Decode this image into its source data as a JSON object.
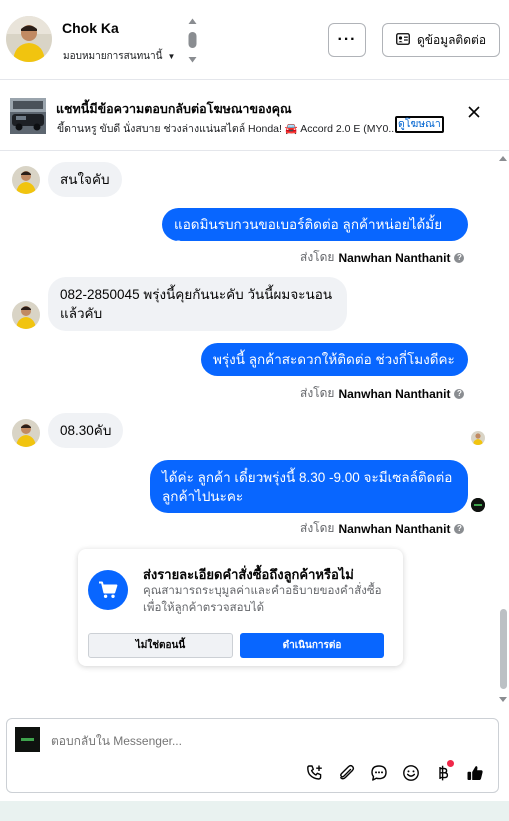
{
  "header": {
    "contact_name": "Chok Ka",
    "assign_label": "มอบหมายการสนทนานี้",
    "more_label": "···",
    "details_label": "ดูข้อมูลติดต่อ"
  },
  "ad_banner": {
    "title": "แชทนี้มีข้อความตอบกลับต่อโฆษณาของคุณ",
    "subtitle": "ขี้ดานหรู ขับดี นั่งสบาย ช่วงล่างแน่นสไตล์ Honda! 🚘 Accord 2.0 E (MY0...",
    "view_ad_label": "ดูโฆษณา"
  },
  "messages": [
    {
      "dir": "in",
      "text": "สนใจคับ"
    },
    {
      "dir": "out",
      "text": "แอดมินรบกวนขอเบอร์ติดต่อ ลูกค้าหน่อยได้มั้ยคะ",
      "sent_by_prefix": "ส่งโดย",
      "sender": "Nanwhan Nanthanit"
    },
    {
      "dir": "in",
      "text": "082-2850045 พรุ่งนี้คุยกันนะคับ วันนี้ผมจะนอนแล้วคับ"
    },
    {
      "dir": "out",
      "text": "พรุ่งนี้ ลูกค้าสะดวกให้ติดต่อ ช่วงกี่โมงดีคะ",
      "sent_by_prefix": "ส่งโดย",
      "sender": "Nanwhan Nanthanit"
    },
    {
      "dir": "in",
      "text": "08.30คับ"
    },
    {
      "dir": "out",
      "text": "ได้ค่ะ  ลูกค้า เดี๋ยวพรุ่งนี้  8.30 -9.00 จะมีเซลล์ติดต่อ ลูกค้าไปนะคะ",
      "sent_by_prefix": "ส่งโดย",
      "sender": "Nanwhan Nanthanit"
    }
  ],
  "order_prompt": {
    "title": "ส่งรายละเอียดคำสั่งซื้อถึงลูกค้าหรือไม่",
    "description": "คุณสามารถระบุมูลค่าและคำอธิบายของคำสั่งซื้อเพื่อให้ลูกค้าตรวจสอบได้",
    "decline_label": "ไม่ใช่ตอนนี้",
    "continue_label": "ดำเนินการต่อ"
  },
  "composer": {
    "placeholder": "ตอบกลับใน Messenger..."
  },
  "colors": {
    "accent": "#0866ff",
    "incoming_bubble": "#f0f2f5",
    "notification_dot": "#f02849"
  }
}
